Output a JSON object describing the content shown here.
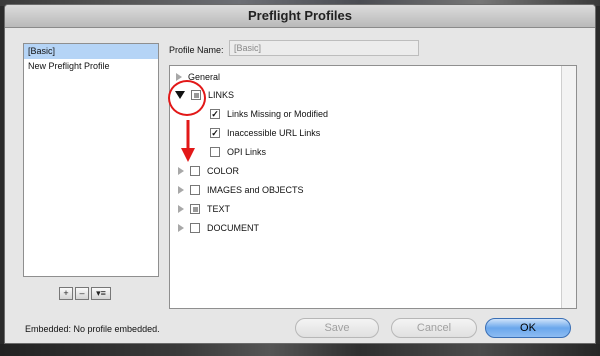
{
  "dialog": {
    "title": "Preflight Profiles"
  },
  "profiles": {
    "items": [
      "[Basic]",
      "New Preflight Profile"
    ],
    "selected_index": 0
  },
  "list_buttons": {
    "add": "+",
    "remove": "–",
    "menu": "▾≡"
  },
  "profile_name": {
    "label": "Profile Name:",
    "value": "[Basic]"
  },
  "tree": {
    "general": "General",
    "links": "LINKS",
    "links_missing": "Links Missing or Modified",
    "inaccessible_url": "Inaccessible URL Links",
    "opi_links": "OPI Links",
    "color": "COLOR",
    "images": "IMAGES and OBJECTS",
    "text": "TEXT",
    "document": "DOCUMENT"
  },
  "status": {
    "embedded": "Embedded:  No profile embedded."
  },
  "buttons": {
    "save": "Save",
    "cancel": "Cancel",
    "ok": "OK"
  },
  "colors": {
    "selection": "#b5d4f6",
    "annotation": "#e21818",
    "ok_button": "#6aa7ec"
  }
}
